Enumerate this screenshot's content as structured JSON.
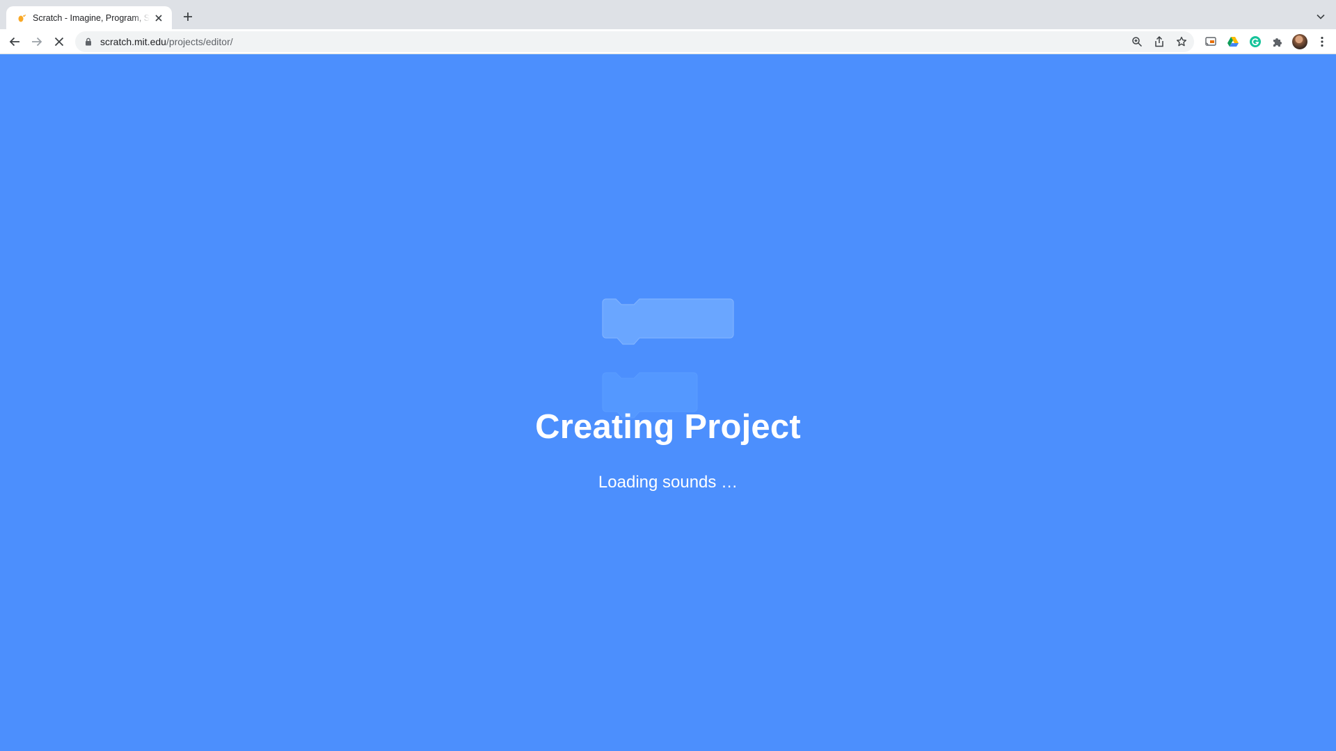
{
  "browser": {
    "tab": {
      "title": "Scratch - Imagine, Program, Share",
      "favicon": "scratch-cat-icon"
    },
    "address_bar": {
      "domain": "scratch.mit.edu",
      "path": "/projects/editor/"
    },
    "toolbar_icons": [
      "back-icon",
      "forward-icon",
      "stop-loading-icon",
      "lock-icon",
      "zoom-icon",
      "share-icon",
      "bookmark-star-icon"
    ],
    "extension_icons": [
      "cast-icon",
      "google-drive-icon",
      "grammarly-icon",
      "extensions-puzzle-icon",
      "profile-avatar",
      "menu-kebab-icon"
    ]
  },
  "page": {
    "background_color": "#4c8ffd",
    "heading": "Creating Project",
    "status": "Loading sounds …"
  }
}
